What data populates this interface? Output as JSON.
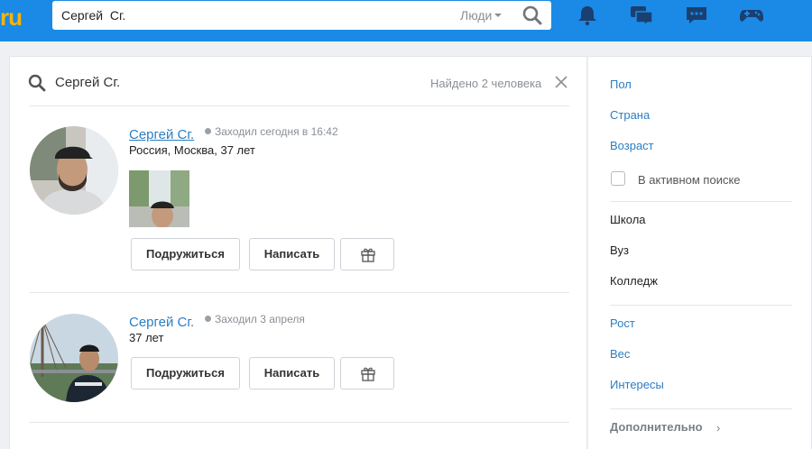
{
  "header": {
    "logo_text": "ru",
    "search_value": "Сергей  Сг.",
    "scope_label": "Люди",
    "icons": [
      "search-icon",
      "bell-icon",
      "messages-icon",
      "chat-icon",
      "gamepad-icon"
    ]
  },
  "results": {
    "query": "Сергей  Сг.",
    "found_label": "Найдено 2 человека",
    "people": [
      {
        "name": "Сергей Сг.",
        "last_seen": "Заходил сегодня в 16:42",
        "info": "Россия, Москва, 37 лет",
        "friend_label": "Подружиться",
        "write_label": "Написать"
      },
      {
        "name": "Сергей Сг.",
        "last_seen": "Заходил 3 апреля",
        "info": "37 лет",
        "friend_label": "Подружиться",
        "write_label": "Написать"
      }
    ]
  },
  "filters": {
    "gender": "Пол",
    "country": "Страна",
    "age": "Возраст",
    "active_search": "В активном поиске",
    "school": "Школа",
    "university": "Вуз",
    "college": "Колледж",
    "height": "Рост",
    "weight": "Вес",
    "interests": "Интересы",
    "more": "Дополнительно"
  },
  "colors": {
    "topbar": "#1a8ae6",
    "logo": "#ffb300",
    "link": "#2a7ec2"
  }
}
